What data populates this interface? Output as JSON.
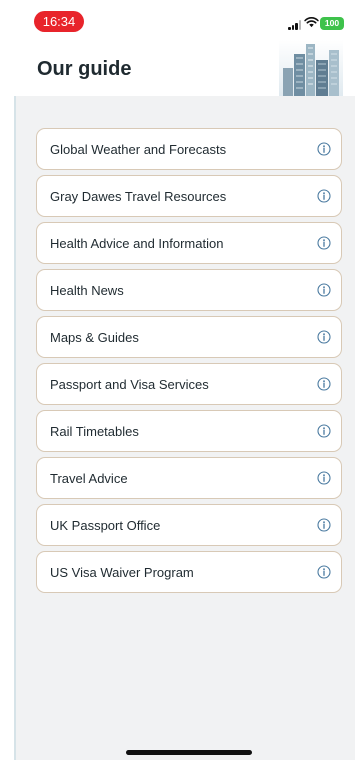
{
  "status_bar": {
    "time": "16:34",
    "battery": "100",
    "time_color": "#e8242b",
    "battery_color": "#3ec24b"
  },
  "header": {
    "title": "Our guide"
  },
  "guide": {
    "items": [
      {
        "label": "Global Weather and Forecasts",
        "icon": "info-icon"
      },
      {
        "label": "Gray Dawes Travel Resources",
        "icon": "info-icon"
      },
      {
        "label": "Health Advice and Information",
        "icon": "info-icon"
      },
      {
        "label": "Health News",
        "icon": "info-icon"
      },
      {
        "label": "Maps & Guides",
        "icon": "info-icon"
      },
      {
        "label": "Passport and Visa Services",
        "icon": "info-icon"
      },
      {
        "label": "Rail Timetables",
        "icon": "info-icon"
      },
      {
        "label": "Travel Advice",
        "icon": "info-icon"
      },
      {
        "label": "UK Passport Office",
        "icon": "info-icon"
      },
      {
        "label": "US Visa Waiver Program",
        "icon": "info-icon"
      }
    ]
  },
  "colors": {
    "item_border": "#d8c9b6",
    "panel_background": "#f1f2f3",
    "icon_blue": "#4a7aa0"
  }
}
